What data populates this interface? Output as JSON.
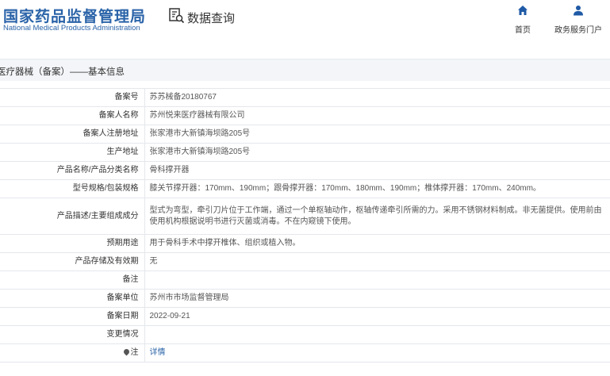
{
  "header": {
    "logo_cn": "国家药品监督管理局",
    "logo_en": "National Medical Products Administration",
    "search_title": "数据查询",
    "nav": [
      {
        "label": "首页",
        "icon": "home-icon"
      },
      {
        "label": "政务服务门户",
        "icon": "user-icon"
      }
    ]
  },
  "section": {
    "title": "医疗器械（备案）——基本信息"
  },
  "rows": [
    {
      "key": "备案号",
      "value": "苏苏械备20180767"
    },
    {
      "key": "备案人名称",
      "value": "苏州悦来医疗器械有限公司"
    },
    {
      "key": "备案人注册地址",
      "value": "张家港市大新镇海坝路205号"
    },
    {
      "key": "生产地址",
      "value": "张家港市大新镇海坝路205号"
    },
    {
      "key": "产品名称/产品分类名称",
      "value": "骨科撑开器"
    },
    {
      "key": "型号规格/包装规格",
      "value": "膝关节撑开器：170mm、190mm；跟骨撑开器：170mm、180mm、190mm；椎体撑开器：170mm、240mm。"
    },
    {
      "key": "产品描述/主要组成成分",
      "value": "型式为弯型，牵引刀片位于工作端，通过一个单枢轴动作，枢轴传递牵引所需的力。采用不锈钢材料制成。非无菌提供。使用前由使用机构根据说明书进行灭菌或消毒。不在内窥镜下使用。"
    },
    {
      "key": "预期用途",
      "value": "用于骨科手术中撑开椎体、组织或植入物。"
    },
    {
      "key": "产品存储及有效期",
      "value": "无"
    },
    {
      "key": "备注",
      "value": ""
    },
    {
      "key": "备案单位",
      "value": "苏州市市场监督管理局"
    },
    {
      "key": "备案日期",
      "value": "2022-09-21"
    },
    {
      "key": "变更情况",
      "value": ""
    },
    {
      "key": "注",
      "value": "详情"
    }
  ],
  "colors": {
    "brand": "#2a63a8",
    "section_bg": "#f3f5f8",
    "border": "#e4e7ec"
  }
}
